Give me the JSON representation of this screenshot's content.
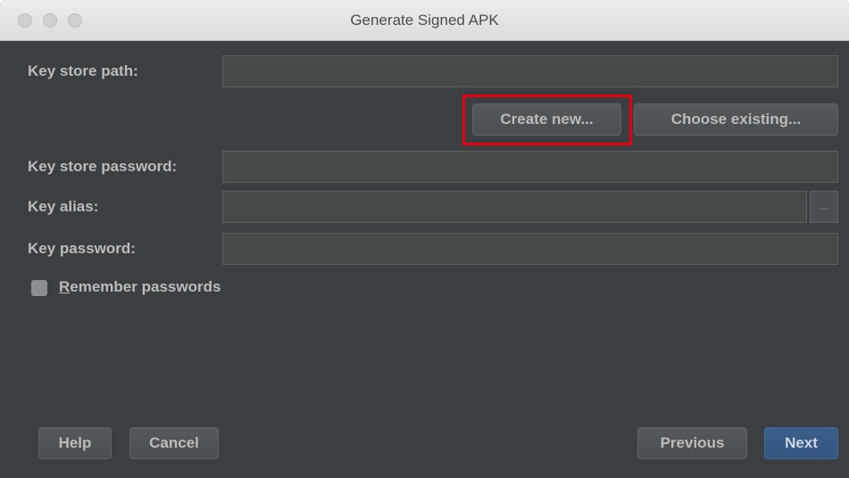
{
  "window": {
    "title": "Generate Signed APK"
  },
  "form": {
    "key_store_path_label": "Key store path:",
    "key_store_path_value": "",
    "create_new_label": "Create new...",
    "choose_existing_label": "Choose existing...",
    "key_store_password_label": "Key store password:",
    "key_store_password_value": "",
    "key_alias_label": "Key alias:",
    "key_alias_value": "",
    "key_alias_browse_label": "...",
    "key_password_label": "Key password:",
    "key_password_value": "",
    "remember_passwords_mnemonic": "R",
    "remember_passwords_rest": "emember passwords",
    "remember_passwords_checked": false
  },
  "footer": {
    "help_label": "Help",
    "cancel_label": "Cancel",
    "previous_label": "Previous",
    "next_label": "Next"
  },
  "colors": {
    "background": "#3c3f41",
    "highlight": "#e60012",
    "primary_button": "#365880"
  }
}
